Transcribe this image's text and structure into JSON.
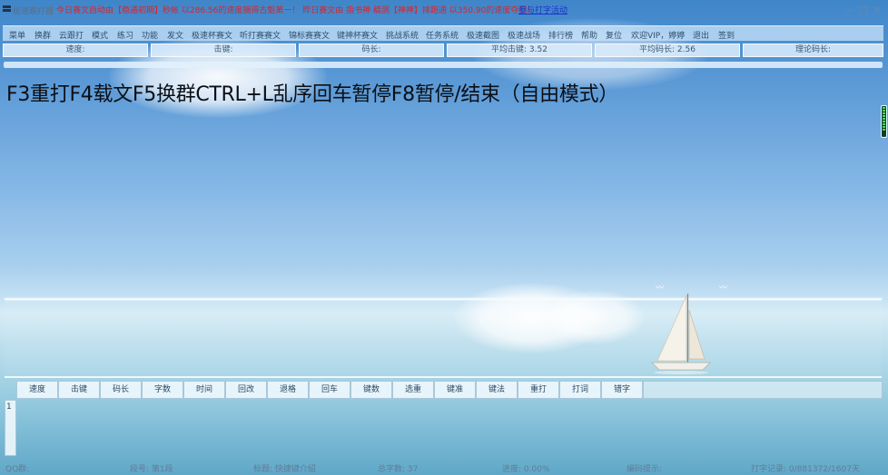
{
  "titlebar": {
    "title": "极速跟打器",
    "notice": "今日赛文自动由【稳通初期】秒帐 以286.56的速度摘得古魁第一！ 昨日赛文由 指书神 稿测【神神】排跑通 以350.90的速度夺冠！",
    "join_link": "参与打字活动",
    "minimize": "—",
    "maximize": "□",
    "close": "×"
  },
  "menu": {
    "items": [
      "菜单",
      "换群",
      "云跟打",
      "模式",
      "练习",
      "功能",
      "发文",
      "极速杯赛文",
      "听打赛赛文",
      "锦标赛赛文",
      "键神杯赛文",
      "挑战系统",
      "任务系统",
      "极速截图",
      "极速战场",
      "排行榜",
      "帮助",
      "复位",
      "欢迎VIP，婷婷",
      "退出",
      "签到"
    ]
  },
  "stats": {
    "speed": "速度:",
    "keystroke": "击键:",
    "code_length": "码长:",
    "avg_keystroke": "平均击键: 3.52",
    "avg_code_length": "平均码长: 2.56",
    "theoretical_code_length": "理论码长:"
  },
  "prompt_text": "F3重打F4载文F5换群CTRL+L乱序回车暂停F8暂停/结束（自由模式）",
  "table": {
    "columns": [
      "速度",
      "击键",
      "码长",
      "字数",
      "时间",
      "回改",
      "退格",
      "回车",
      "键数",
      "选重",
      "键准",
      "键法",
      "重打",
      "打词",
      "错字"
    ],
    "rows": [
      "1"
    ]
  },
  "statusbar": {
    "qq_group": "QQ群:",
    "segment": "段号: 第1段",
    "article_title": "标题: 快捷键介绍",
    "total_chars": "总字数: 37",
    "progress": "进度: 0.00%",
    "code_hint": "编码提示:",
    "typing_record": "打字记录: 0/881372/1607天"
  },
  "colors": {
    "notice": "#d8242c",
    "link": "#1a34c8",
    "prompt": "#0b0f16"
  }
}
